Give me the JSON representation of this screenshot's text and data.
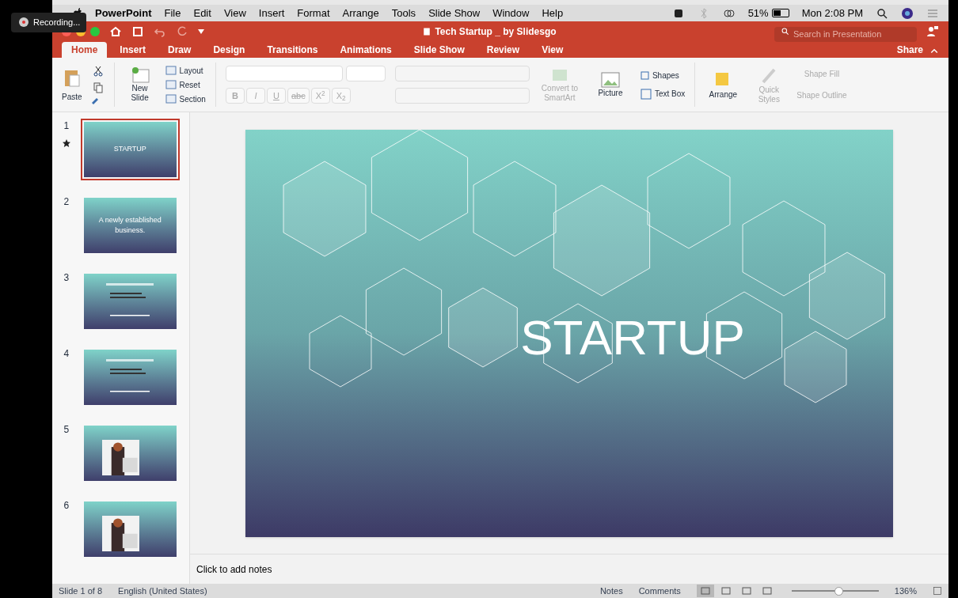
{
  "recording": {
    "label": "Recording..."
  },
  "menu_bar": {
    "app": "PowerPoint",
    "items": [
      "File",
      "Edit",
      "View",
      "Insert",
      "Format",
      "Arrange",
      "Tools",
      "Slide Show",
      "Window",
      "Help"
    ],
    "battery": "51%",
    "clock": "Mon 2:08 PM"
  },
  "title_bar": {
    "title": "Tech Startup _ by Slidesgo",
    "search": {
      "placeholder": "Search in Presentation"
    }
  },
  "tabs": [
    {
      "label": "Home",
      "selected": true
    },
    {
      "label": "Insert",
      "selected": false
    },
    {
      "label": "Draw",
      "selected": false
    },
    {
      "label": "Design",
      "selected": false
    },
    {
      "label": "Transitions",
      "selected": false
    },
    {
      "label": "Animations",
      "selected": false
    },
    {
      "label": "Slide Show",
      "selected": false
    },
    {
      "label": "Review",
      "selected": false
    },
    {
      "label": "View",
      "selected": false
    }
  ],
  "share": "Share",
  "ribbon": {
    "paste": "Paste",
    "new_slide": "New Slide",
    "layout": "Layout",
    "reset": "Reset",
    "section": "Section",
    "format_buttons": [
      {
        "label": "B",
        "kind": "bold"
      },
      {
        "label": "I",
        "kind": "italic"
      },
      {
        "label": "U",
        "kind": "underline"
      },
      {
        "label": "abc",
        "kind": "strike"
      },
      {
        "label": "X$^{2}$",
        "kind": "plain"
      },
      {
        "label": "X$_{2}$",
        "kind": "plain"
      }
    ],
    "tools": [
      {
        "label": "Convert to SmartArt",
        "disabled": true,
        "kind": "smartart"
      },
      {
        "label": "Picture",
        "disabled": false,
        "kind": "picture"
      },
      {
        "label": "Arrange",
        "disabled": false,
        "kind": "arrange"
      },
      {
        "label": "Quick Styles",
        "disabled": true,
        "kind": "styles"
      }
    ],
    "shapes": "Shapes",
    "text_box": "Text Box",
    "shape_fill": {
      "label": "Shape Fill",
      "disabled": true
    },
    "shape_outline": {
      "label": "Shape Outline",
      "disabled": true
    }
  },
  "slides": [
    {
      "number": "1",
      "selected": true,
      "title": "STARTUP",
      "starred": true
    },
    {
      "number": "2",
      "selected": false,
      "title": "A newly established business.",
      "starred": false
    },
    {
      "number": "3",
      "selected": false,
      "starred": false
    },
    {
      "number": "4",
      "selected": false,
      "starred": false
    },
    {
      "number": "5",
      "selected": false,
      "starred": false
    },
    {
      "number": "6",
      "selected": false,
      "starred": false
    }
  ],
  "slide": {
    "title": "STARTUP"
  },
  "notes": {
    "placeholder": "Click to add notes"
  },
  "status_bar": {
    "slide": "Slide 1 of 8",
    "language": "English (United States)",
    "notes": "Notes",
    "comments": "Comments",
    "zoom_slider": {
      "level": 0.55
    },
    "zoom": "136%",
    "views": [
      {
        "selected": true
      },
      {
        "selected": false
      },
      {
        "selected": false
      },
      {
        "selected": false
      }
    ]
  }
}
